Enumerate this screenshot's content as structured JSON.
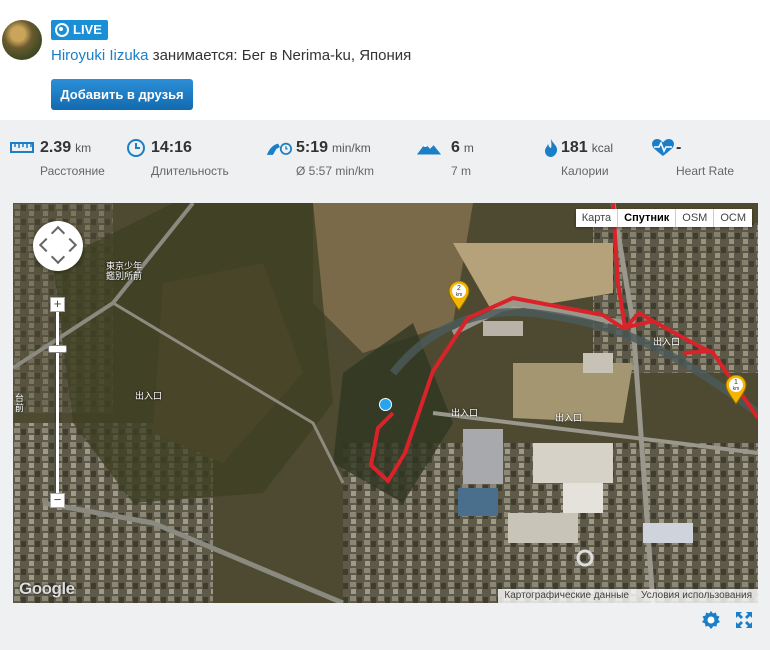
{
  "header": {
    "live_label": "LIVE",
    "user_name": "Hiroyuki Iizuka",
    "activity_text": " занимается: Бег в Nerima-ku, Япония",
    "add_friend_label": "Добавить в друзья"
  },
  "stats": [
    {
      "icon": "ruler-icon",
      "value": "2.39",
      "unit": "km",
      "label": "Расстояние"
    },
    {
      "icon": "clock-icon",
      "value": "14:16",
      "unit": "",
      "label": "Длительность"
    },
    {
      "icon": "running-shoe-icon",
      "value": "5:19",
      "unit": "min/km",
      "label": "Ø 5:57 min/km"
    },
    {
      "icon": "mountain-icon",
      "value": "6",
      "unit": "m",
      "label": "7 m"
    },
    {
      "icon": "flame-icon",
      "value": "181",
      "unit": "kcal",
      "label": "Калории"
    },
    {
      "icon": "heart-rate-icon",
      "value": "-",
      "unit": "",
      "label": "Heart Rate"
    }
  ],
  "map": {
    "types": [
      "Карта",
      "Спутник",
      "OSM",
      "OCM"
    ],
    "active_type": "Спутник",
    "zoom_in": "+",
    "zoom_out": "−",
    "km_markers": [
      "2",
      "1"
    ],
    "km_unit": "km",
    "google_label": "Google",
    "footer_data": "Картографические данные",
    "footer_terms": "Условия использования",
    "labels": [
      "東京少年鑑別所前",
      "台前",
      "出入口",
      "出入口",
      "出入口",
      "出入口"
    ]
  },
  "colors": {
    "accent": "#1a7fc6",
    "button": "#1a78c2",
    "route": "#d8232a",
    "marker": "#f5b400",
    "point": "#2aa3ee"
  }
}
